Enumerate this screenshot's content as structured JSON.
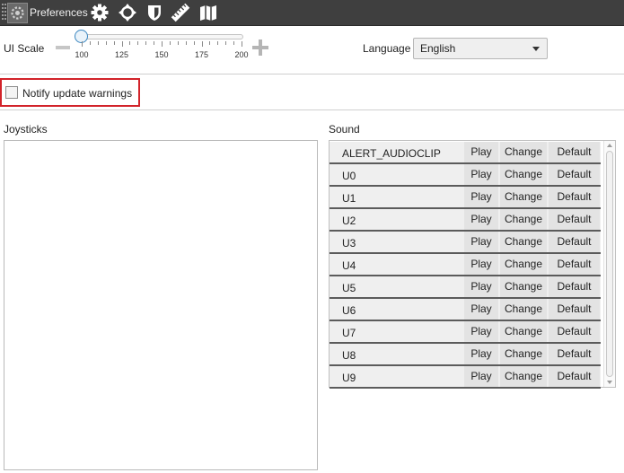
{
  "toolbar": {
    "preferences_label": "Preferences",
    "icons": [
      "gear-icon",
      "crosshair-icon",
      "shield-icon",
      "ruler-icon",
      "map-icon"
    ]
  },
  "ui_scale": {
    "label": "UI Scale",
    "value": 100,
    "min": 100,
    "max": 200,
    "tick_labels": [
      "100",
      "125",
      "150",
      "175",
      "200"
    ]
  },
  "language": {
    "label": "Language",
    "selected": "English"
  },
  "notify": {
    "label": "Notify update warnings",
    "checked": false,
    "highlight_color": "#d2232a"
  },
  "joysticks": {
    "title": "Joysticks"
  },
  "sound": {
    "title": "Sound",
    "play_label": "Play",
    "change_label": "Change",
    "default_label": "Default",
    "rows": [
      "ALERT_AUDIOCLIP",
      "U0",
      "U1",
      "U2",
      "U3",
      "U4",
      "U5",
      "U6",
      "U7",
      "U8",
      "U9"
    ]
  }
}
